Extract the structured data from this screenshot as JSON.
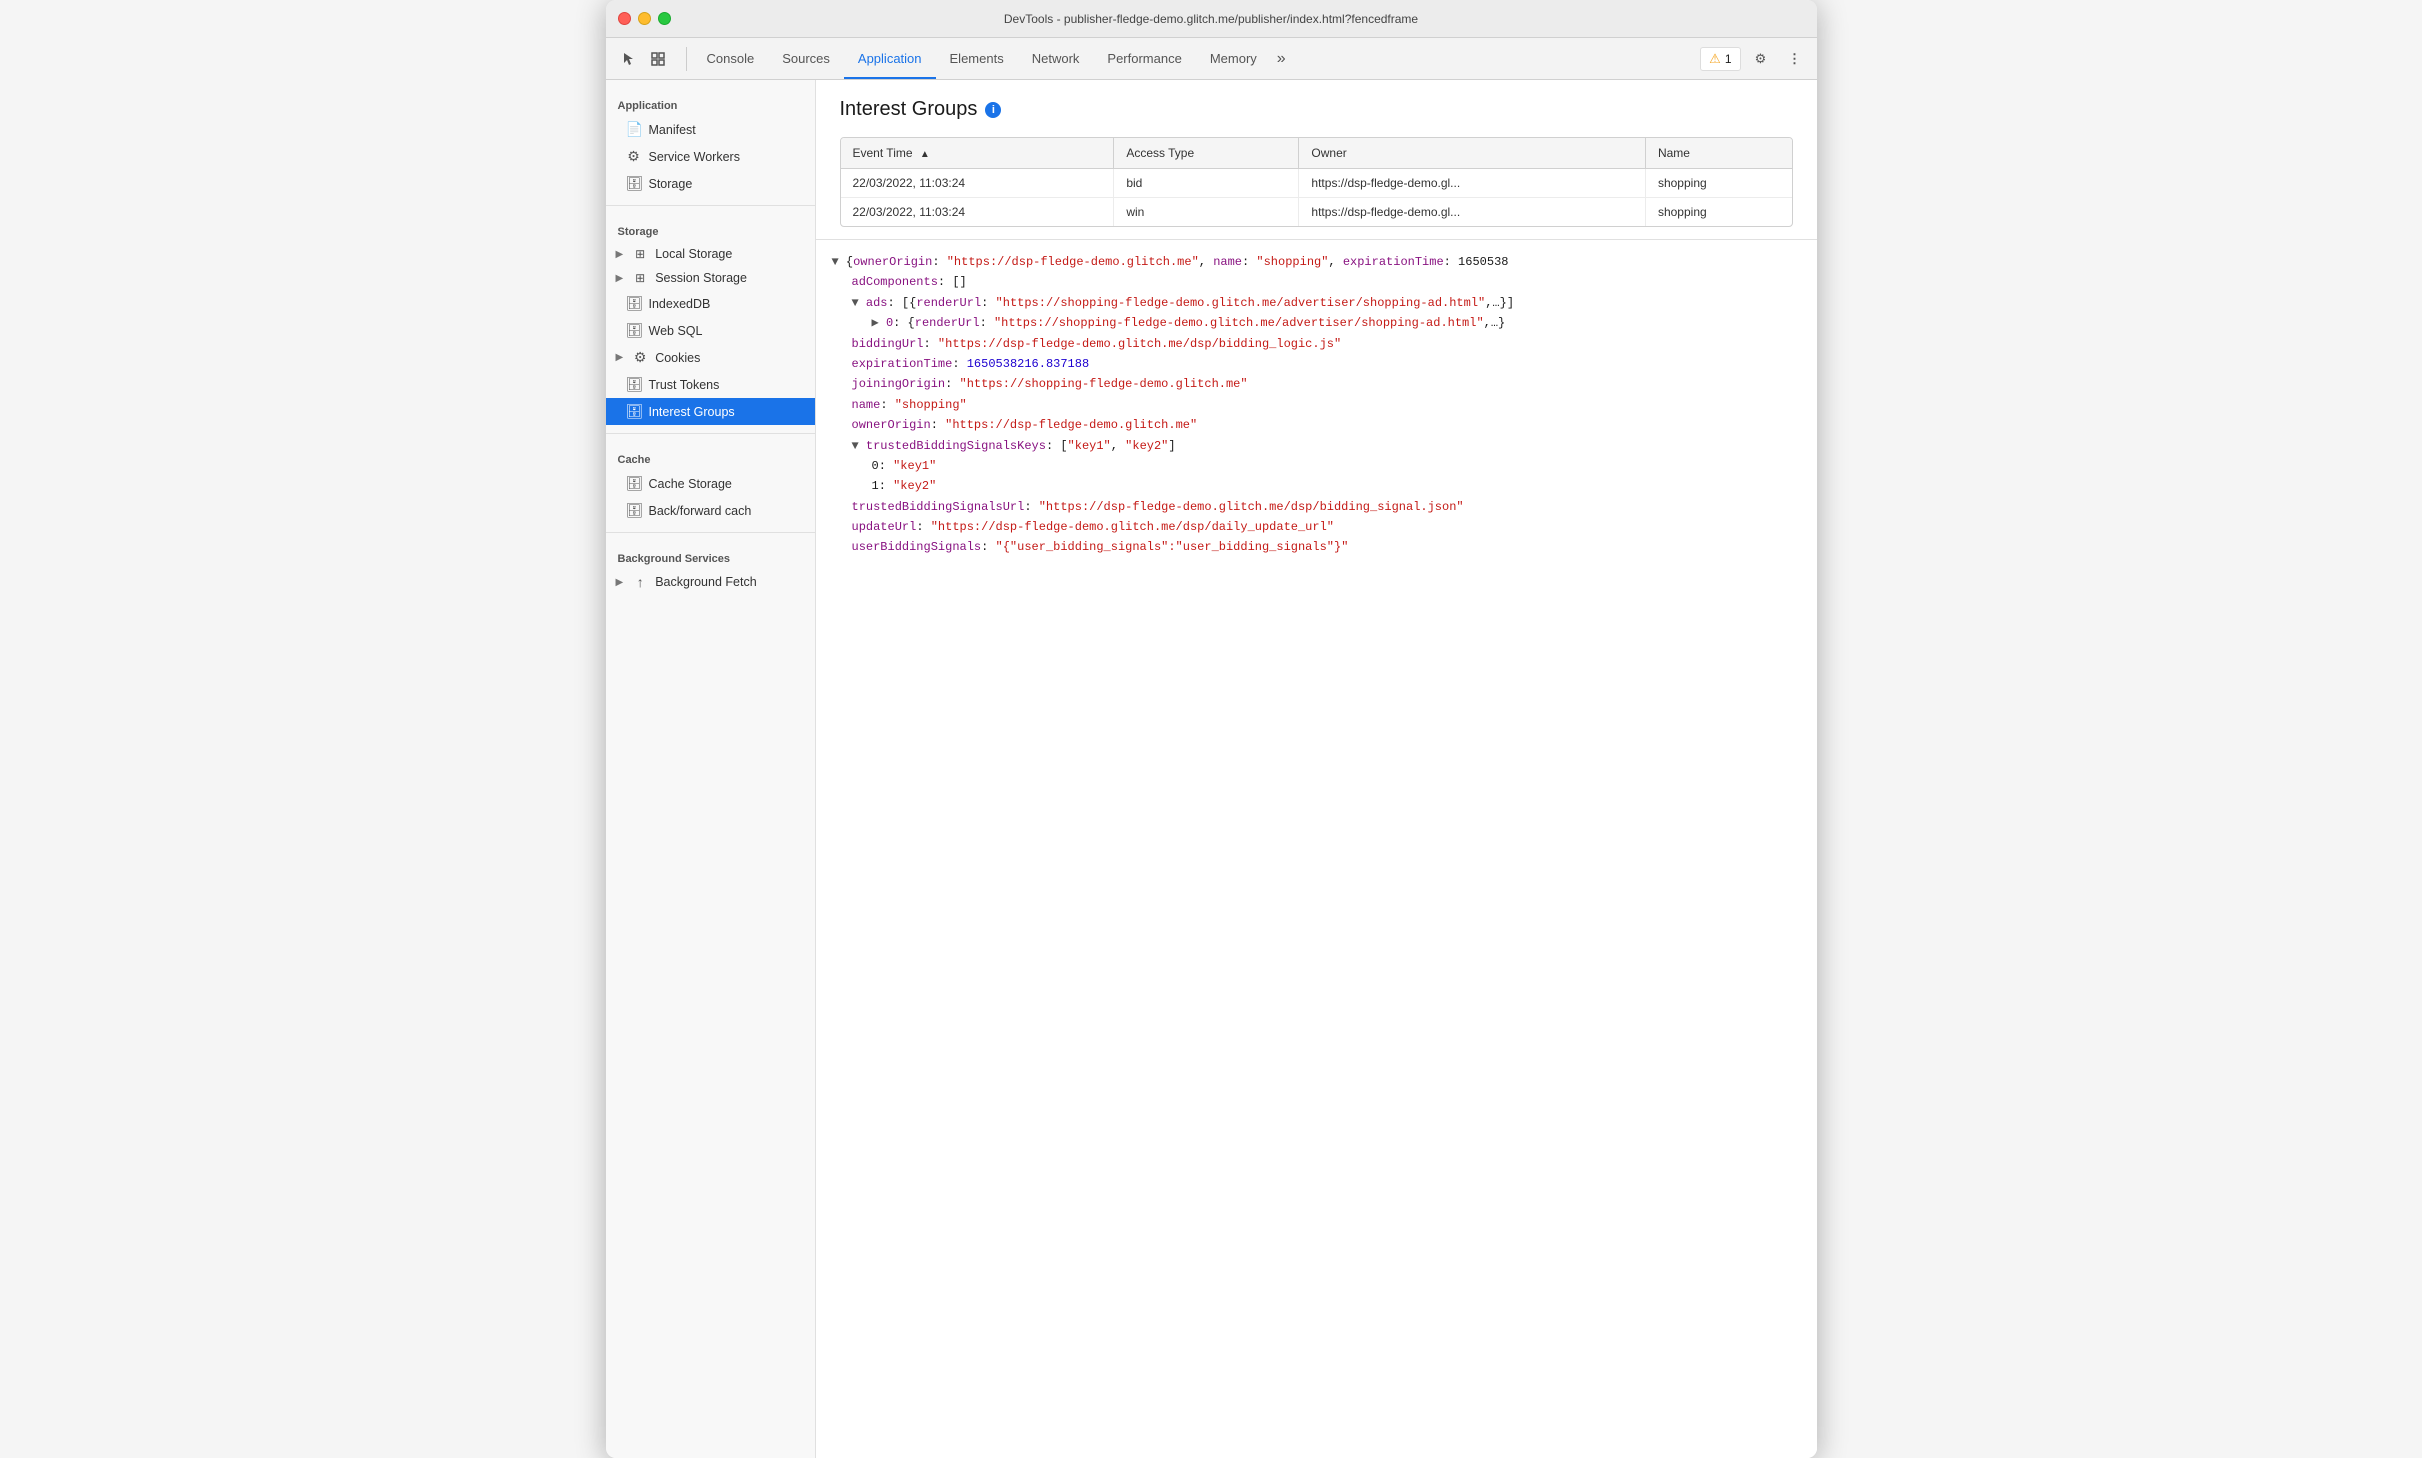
{
  "titlebar": {
    "title": "DevTools - publisher-fledge-demo.glitch.me/publisher/index.html?fencedframe"
  },
  "toolbar": {
    "tabs": [
      {
        "id": "console",
        "label": "Console",
        "active": false
      },
      {
        "id": "sources",
        "label": "Sources",
        "active": false
      },
      {
        "id": "application",
        "label": "Application",
        "active": true
      },
      {
        "id": "elements",
        "label": "Elements",
        "active": false
      },
      {
        "id": "network",
        "label": "Network",
        "active": false
      },
      {
        "id": "performance",
        "label": "Performance",
        "active": false
      },
      {
        "id": "memory",
        "label": "Memory",
        "active": false
      }
    ],
    "more_label": "»",
    "warning_count": "1",
    "settings_label": "⚙",
    "more_options": "⋮"
  },
  "sidebar": {
    "app_section": "Application",
    "app_items": [
      {
        "id": "manifest",
        "label": "Manifest",
        "icon": "📄"
      },
      {
        "id": "service-workers",
        "label": "Service Workers",
        "icon": "⚙"
      },
      {
        "id": "storage",
        "label": "Storage",
        "icon": "🗄"
      }
    ],
    "storage_section": "Storage",
    "storage_items": [
      {
        "id": "local-storage",
        "label": "Local Storage",
        "icon": "▶",
        "hasArrow": true,
        "icon2": "⊞"
      },
      {
        "id": "session-storage",
        "label": "Session Storage",
        "icon": "▶",
        "hasArrow": true,
        "icon2": "⊞"
      },
      {
        "id": "indexed-db",
        "label": "IndexedDB",
        "icon": "🗄"
      },
      {
        "id": "web-sql",
        "label": "Web SQL",
        "icon": "🗄"
      },
      {
        "id": "cookies",
        "label": "Cookies",
        "icon": "▶",
        "hasArrow": true,
        "icon2": "🍪"
      },
      {
        "id": "trust-tokens",
        "label": "Trust Tokens",
        "icon": "🗄"
      },
      {
        "id": "interest-groups",
        "label": "Interest Groups",
        "icon": "🗄",
        "active": true
      }
    ],
    "cache_section": "Cache",
    "cache_items": [
      {
        "id": "cache-storage",
        "label": "Cache Storage",
        "icon": "🗄"
      },
      {
        "id": "backforward-cache",
        "label": "Back/forward cach",
        "icon": "🗄"
      }
    ],
    "bg_section": "Background Services",
    "bg_items": [
      {
        "id": "background-fetch",
        "label": "Background Fetch",
        "icon": "↑",
        "hasArrow": true
      }
    ]
  },
  "content": {
    "title": "Interest Groups",
    "table": {
      "columns": [
        "Event Time",
        "Access Type",
        "Owner",
        "Name"
      ],
      "rows": [
        {
          "event_time": "22/03/2022, 11:03:24",
          "access_type": "bid",
          "owner": "https://dsp-fledge-demo.gl...",
          "name": "shopping"
        },
        {
          "event_time": "22/03/2022, 11:03:24",
          "access_type": "win",
          "owner": "https://dsp-fledge-demo.gl...",
          "name": "shopping"
        }
      ]
    },
    "detail": {
      "line1": "▼ {ownerOrigin: \"https://dsp-fledge-demo.glitch.me\", name: \"shopping\", expirationTime: 1650538",
      "lines": [
        {
          "indent": 1,
          "type": "key-plain",
          "key": "adComponents:",
          "value": " []"
        },
        {
          "indent": 1,
          "type": "expand-key",
          "arrow": "▼",
          "key": "ads:",
          "value": " [{renderUrl: \"https://shopping-fledge-demo.glitch.me/advertiser/shopping-ad.html\",…}]"
        },
        {
          "indent": 2,
          "type": "expand-key",
          "arrow": "▶",
          "key": "0:",
          "value": " {renderUrl: \"https://shopping-fledge-demo.glitch.me/advertiser/shopping-ad.html\",…}"
        },
        {
          "indent": 1,
          "type": "key-val",
          "key": "biddingUrl:",
          "value": " \"https://dsp-fledge-demo.glitch.me/dsp/bidding_logic.js\""
        },
        {
          "indent": 1,
          "type": "key-val-num",
          "key": "expirationTime:",
          "value": " 1650538216.837188"
        },
        {
          "indent": 1,
          "type": "key-val",
          "key": "joiningOrigin:",
          "value": " \"https://shopping-fledge-demo.glitch.me\""
        },
        {
          "indent": 1,
          "type": "key-val",
          "key": "name:",
          "value": " \"shopping\""
        },
        {
          "indent": 1,
          "type": "key-val",
          "key": "ownerOrigin:",
          "value": " \"https://dsp-fledge-demo.glitch.me\""
        },
        {
          "indent": 1,
          "type": "expand-array",
          "arrow": "▼",
          "key": "trustedBiddingSignalsKeys:",
          "value": " [\"key1\", \"key2\"]"
        },
        {
          "indent": 2,
          "type": "key-val",
          "key": "0:",
          "value": " \"key1\""
        },
        {
          "indent": 2,
          "type": "key-val",
          "key": "1:",
          "value": " \"key2\""
        },
        {
          "indent": 1,
          "type": "key-val",
          "key": "trustedBiddingSignalsUrl:",
          "value": " \"https://dsp-fledge-demo.glitch.me/dsp/bidding_signal.json\""
        },
        {
          "indent": 1,
          "type": "key-val",
          "key": "updateUrl:",
          "value": " \"https://dsp-fledge-demo.glitch.me/dsp/daily_update_url\""
        },
        {
          "indent": 1,
          "type": "key-val",
          "key": "userBiddingSignals:",
          "value": " \"{\\\"user_bidding_signals\\\":\\\"user_bidding_signals\\\"}\""
        }
      ]
    }
  }
}
